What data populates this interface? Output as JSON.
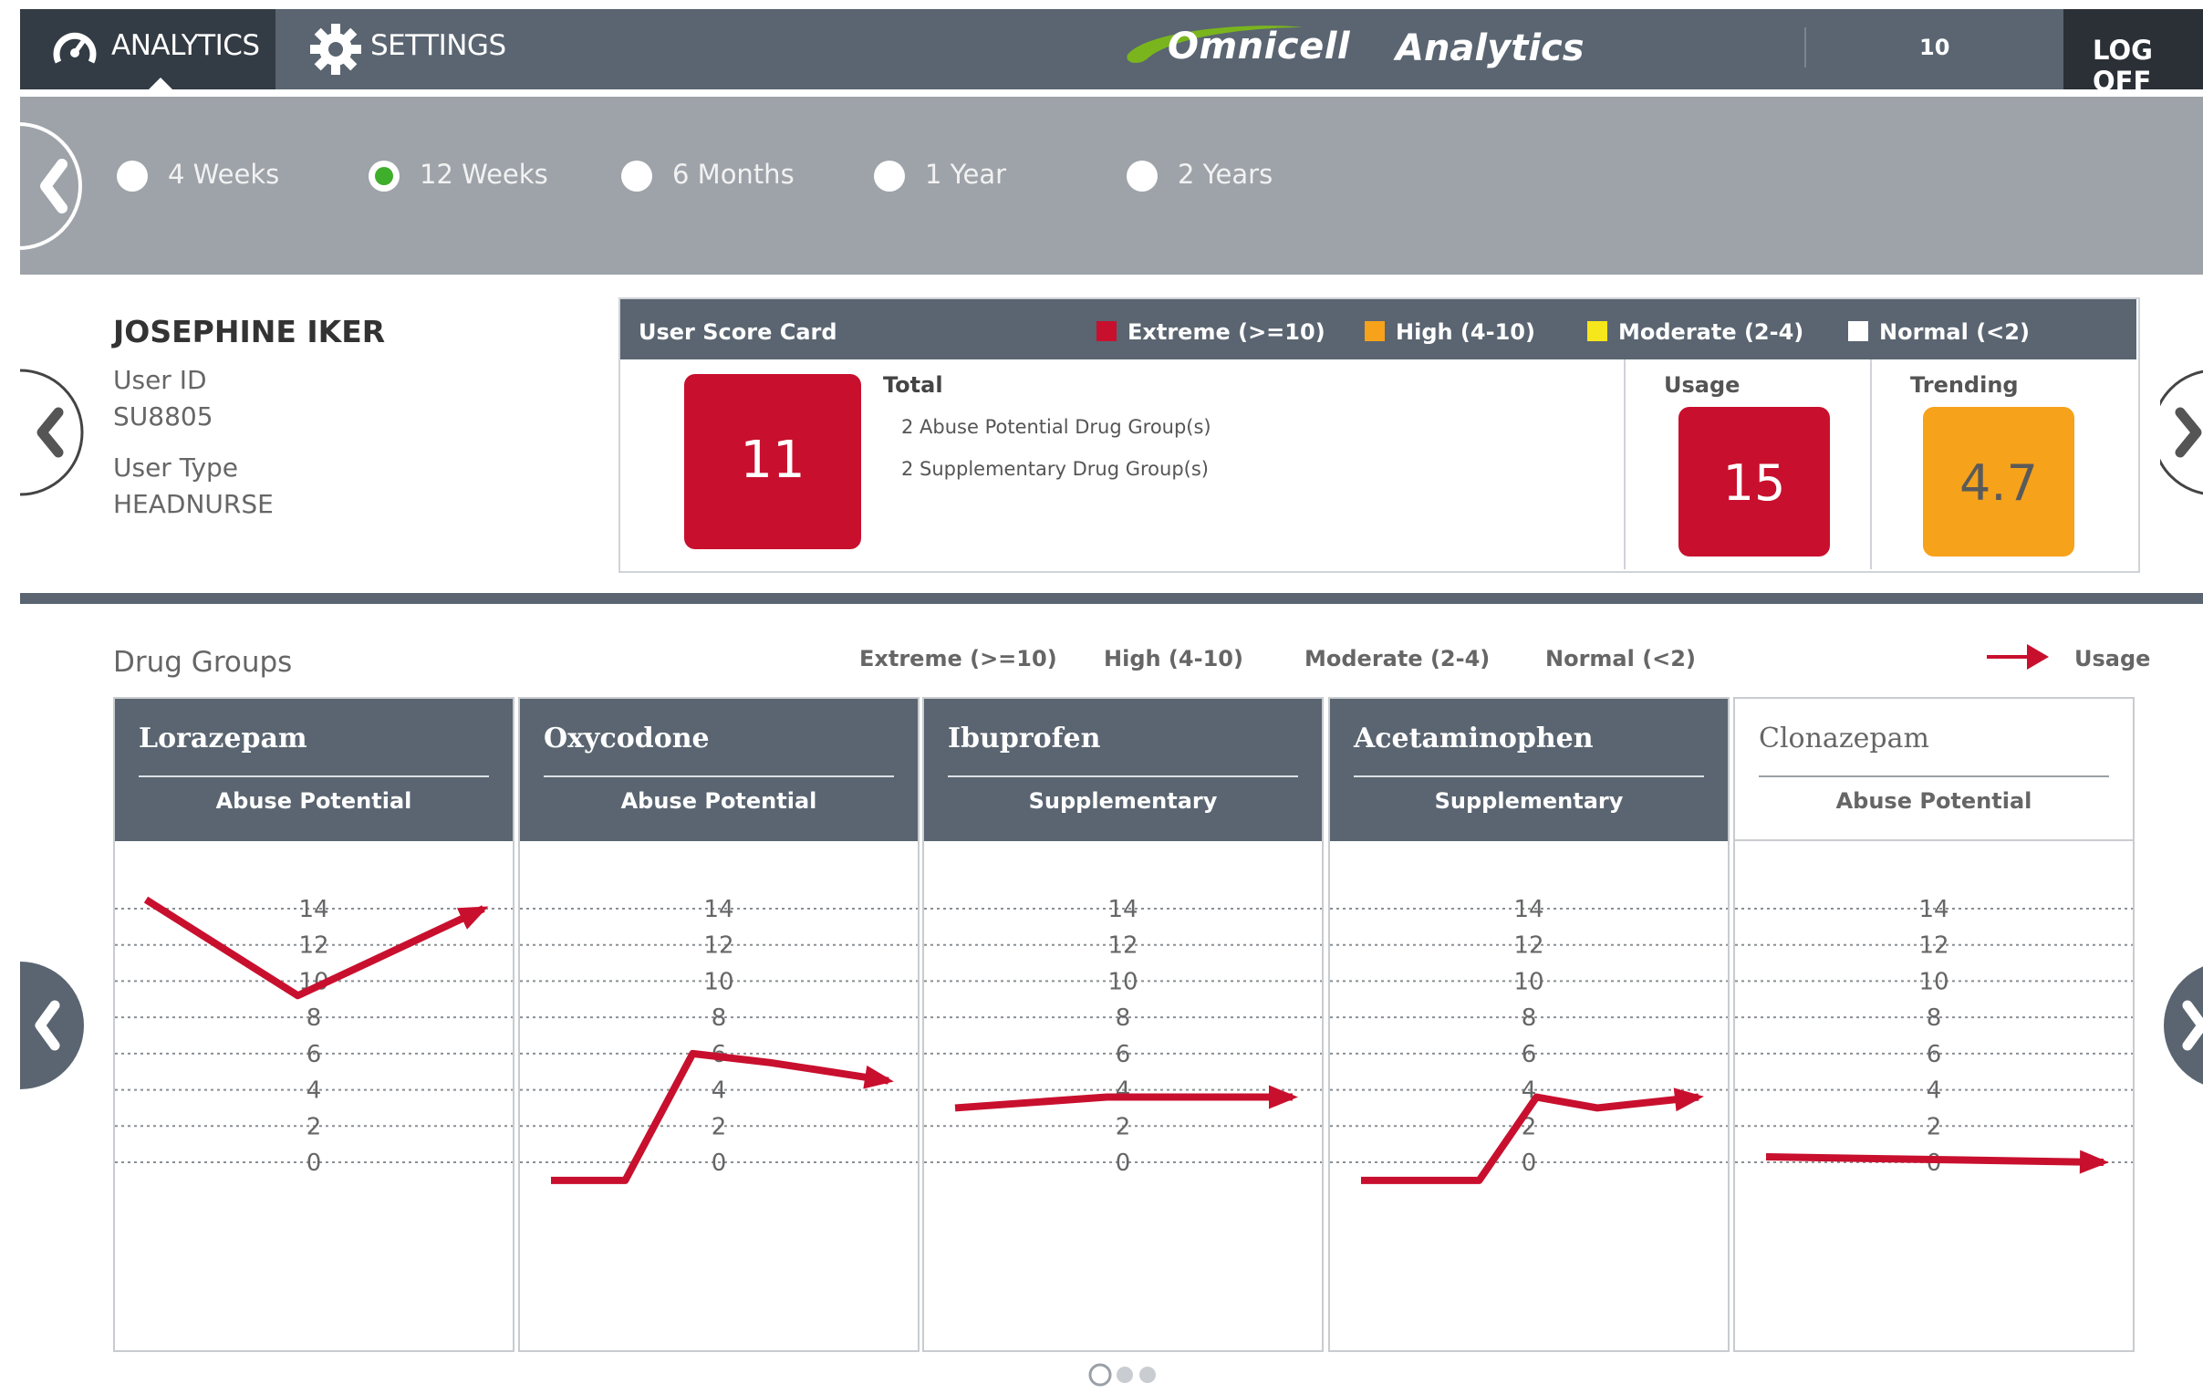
{
  "header": {
    "tabs": [
      {
        "label": "ANALYTICS",
        "icon": "analytics-icon",
        "active": true
      },
      {
        "label": "SETTINGS",
        "icon": "gear-icon",
        "active": false
      }
    ],
    "brand_name": "Omnicell",
    "brand_product": "Analytics",
    "count": "10",
    "logoff_label": "LOG OFF"
  },
  "period": {
    "options": [
      "4 Weeks",
      "12 Weeks",
      "6 Months",
      "1 Year",
      "2 Years"
    ],
    "selected": "12 Weeks"
  },
  "user": {
    "name": "JOSEPHINE IKER",
    "id_label": "User ID",
    "id_value": "SU8805",
    "type_label": "User Type",
    "type_value": "HEADNURSE"
  },
  "scorecard": {
    "title": "User Score Card",
    "legend": [
      {
        "label": "Extreme (>=10)",
        "color": "#c8102e"
      },
      {
        "label": "High (4-10)",
        "color": "#f7a21b"
      },
      {
        "label": "Moderate (2-4)",
        "color": "#f6e61c"
      },
      {
        "label": "Normal (<2)",
        "color": "#ffffff"
      }
    ],
    "total_label": "Total",
    "total_score": "11",
    "total_color": "#c8102e",
    "details": [
      "2 Abuse Potential Drug Group(s)",
      "2 Supplementary Drug Group(s)"
    ],
    "usage_label": "Usage",
    "usage_score": "15",
    "usage_color": "#c8102e",
    "trending_label": "Trending",
    "trending_score": "4.7",
    "trending_color": "#f7a21b"
  },
  "drug_groups": {
    "title": "Drug Groups",
    "legend": [
      "Extreme (>=10)",
      "High (4-10)",
      "Moderate (2-4)",
      "Normal (<2)"
    ],
    "usage_legend": "Usage",
    "usage_color": "#c8102e",
    "axis_ticks": [
      "14",
      "12",
      "10",
      "8",
      "6",
      "4",
      "2",
      "0"
    ],
    "cards": [
      {
        "name": "Lorazepam",
        "type": "Abuse Potential"
      },
      {
        "name": "Oxycodone",
        "type": "Abuse Potential"
      },
      {
        "name": "Ibuprofen",
        "type": "Supplementary"
      },
      {
        "name": "Acetaminophen",
        "type": "Supplementary"
      },
      {
        "name": "Clonazepam",
        "type": "Abuse Potential"
      }
    ]
  },
  "chart_data": [
    {
      "type": "line",
      "title": "Lorazepam",
      "series": [
        {
          "name": "Usage",
          "x": [
            0,
            0.45,
            1
          ],
          "values": [
            14.5,
            9.2,
            14.0
          ]
        }
      ],
      "ylim": [
        0,
        14
      ],
      "grid": true
    },
    {
      "type": "line",
      "title": "Oxycodone",
      "series": [
        {
          "name": "Usage",
          "x": [
            0,
            0.22,
            0.42,
            0.65,
            1
          ],
          "values": [
            -1.0,
            -1.0,
            6.0,
            5.5,
            4.5
          ]
        }
      ],
      "ylim": [
        0,
        14
      ],
      "grid": true
    },
    {
      "type": "line",
      "title": "Ibuprofen",
      "series": [
        {
          "name": "Usage",
          "x": [
            0,
            0.45,
            1
          ],
          "values": [
            3.0,
            3.6,
            3.6
          ]
        }
      ],
      "ylim": [
        0,
        14
      ],
      "grid": true
    },
    {
      "type": "line",
      "title": "Acetaminophen",
      "series": [
        {
          "name": "Usage",
          "x": [
            0,
            0.35,
            0.52,
            0.7,
            1
          ],
          "values": [
            -1.0,
            -1.0,
            3.6,
            3.0,
            3.6
          ]
        }
      ],
      "ylim": [
        0,
        14
      ],
      "grid": true
    },
    {
      "type": "line",
      "title": "Clonazepam",
      "series": [
        {
          "name": "Usage",
          "x": [
            0,
            1
          ],
          "values": [
            0.3,
            0.0
          ]
        }
      ],
      "ylim": [
        0,
        14
      ],
      "grid": true
    }
  ]
}
